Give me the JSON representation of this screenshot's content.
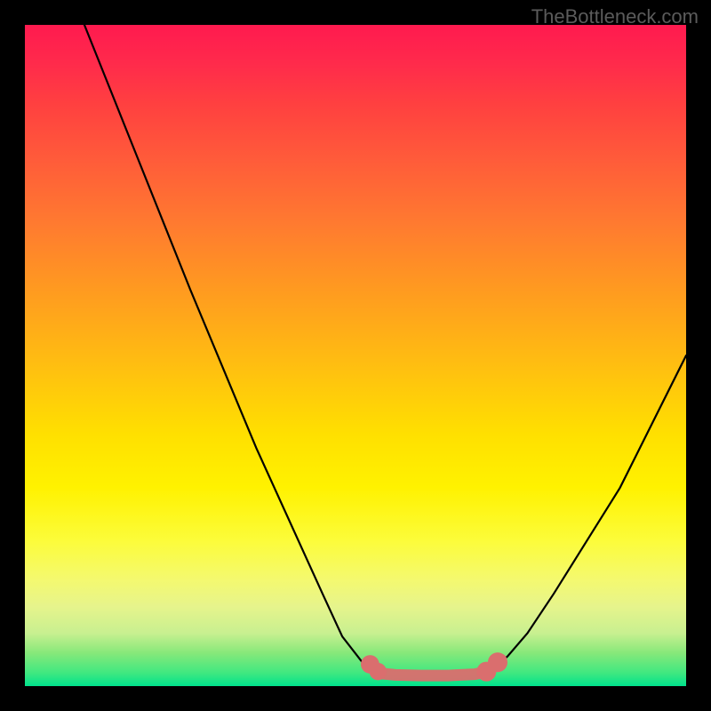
{
  "watermark": "TheBottleneck.com",
  "chart_data": {
    "type": "line",
    "title": "",
    "xlabel": "",
    "ylabel": "",
    "xlim": [
      0,
      100
    ],
    "ylim": [
      0,
      100
    ],
    "grid": false,
    "legend": false,
    "annotations": [],
    "series": [
      {
        "name": "left-curve",
        "stroke": "#000000",
        "x": [
          9,
          15,
          25,
          35,
          45,
          48,
          51.5,
          53
        ],
        "y": [
          100,
          85,
          60,
          36,
          14,
          7.5,
          3,
          2
        ]
      },
      {
        "name": "right-curve",
        "stroke": "#000000",
        "x": [
          100,
          95,
          90,
          85,
          80,
          76,
          73,
          71,
          70
        ],
        "y": [
          50,
          40,
          30,
          22,
          14,
          8,
          4.5,
          2.8,
          2
        ]
      },
      {
        "name": "bottom-band",
        "stroke": "#da6e6e",
        "x": [
          52,
          53,
          54,
          56,
          60,
          64,
          68,
          70,
          71,
          72
        ],
        "y": [
          3.2,
          2.3,
          1.9,
          1.7,
          1.6,
          1.6,
          1.8,
          2.2,
          3.0,
          4.0
        ]
      }
    ],
    "points": [
      {
        "name": "dot-left-upper",
        "x": 52.2,
        "y": 3.3,
        "r": 1.1,
        "fill": "#da6e6e"
      },
      {
        "name": "dot-left-lower",
        "x": 53.4,
        "y": 2.2,
        "r": 1.0,
        "fill": "#da6e6e"
      },
      {
        "name": "dot-right-lower",
        "x": 69.8,
        "y": 2.2,
        "r": 1.2,
        "fill": "#da6e6e"
      },
      {
        "name": "dot-right-upper",
        "x": 71.5,
        "y": 3.6,
        "r": 1.2,
        "fill": "#da6e6e"
      }
    ],
    "gradient_stops": [
      {
        "pos": 0,
        "color": "#ff1a4f"
      },
      {
        "pos": 6,
        "color": "#ff2b4b"
      },
      {
        "pos": 12,
        "color": "#ff4040"
      },
      {
        "pos": 20,
        "color": "#ff5a3a"
      },
      {
        "pos": 30,
        "color": "#ff7a30"
      },
      {
        "pos": 40,
        "color": "#ff9a20"
      },
      {
        "pos": 52,
        "color": "#ffc010"
      },
      {
        "pos": 62,
        "color": "#ffe000"
      },
      {
        "pos": 70,
        "color": "#fff200"
      },
      {
        "pos": 78,
        "color": "#fcfc3a"
      },
      {
        "pos": 84,
        "color": "#f4f970"
      },
      {
        "pos": 88,
        "color": "#e6f48c"
      },
      {
        "pos": 92,
        "color": "#c8f090"
      },
      {
        "pos": 95,
        "color": "#86e87a"
      },
      {
        "pos": 98,
        "color": "#40e880"
      },
      {
        "pos": 100,
        "color": "#00e28c"
      }
    ]
  }
}
